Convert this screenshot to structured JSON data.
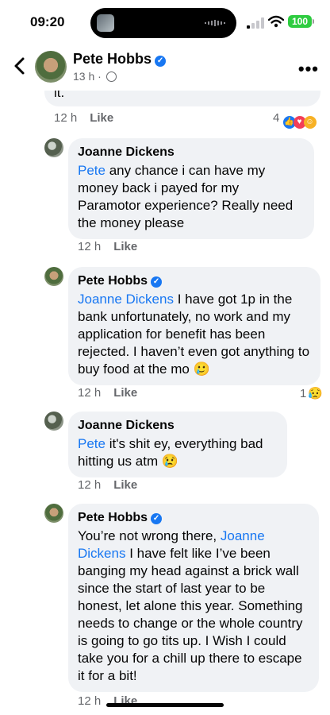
{
  "status": {
    "time": "09:20",
    "battery": "100"
  },
  "header": {
    "name": "Pete Hobbs",
    "time": "13 h ·"
  },
  "top": {
    "text": "it.",
    "time": "12 h",
    "like": "Like",
    "reactions": "4"
  },
  "comments": [
    {
      "author": "Joanne Dickens",
      "mention": "Pete",
      "text": " any chance i can have my money back i payed for my Paramotor experience? Really need the money please",
      "time": "12 h",
      "like": "Like"
    },
    {
      "author": "Pete Hobbs",
      "mention": "Joanne Dickens",
      "text": " I have got 1p in the bank unfortunately, no work and my application for benefit has been rejected. I haven’t even got anything to buy food at the mo 🥲",
      "time": "12 h",
      "like": "Like",
      "reactions": "1"
    },
    {
      "author": "Joanne Dickens",
      "mention": "Pete",
      "text": " it's shit ey, everything bad hitting us atm 😢",
      "time": "12 h",
      "like": "Like"
    },
    {
      "author": "Pete Hobbs",
      "pre": "You’re not wrong there, ",
      "mention": "Joanne Dickens",
      "text": " I have felt like I’ve been banging my head against a brick wall since the start of last year to be honest, let alone this year. Something needs to change or the whole country is going to go tits up. I Wish I could take you for a chill up there to escape it for a bit!",
      "time": "12 h",
      "like": "Like"
    }
  ],
  "colors": {
    "accent": "#1877f2",
    "bubble": "#f0f2f5",
    "battery": "#2ecc40"
  }
}
